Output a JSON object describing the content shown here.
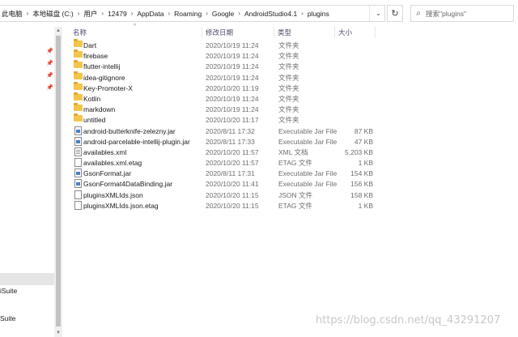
{
  "address_bar": {
    "crumbs": [
      "此电脑",
      "本地磁盘 (C:)",
      "用户",
      "12479",
      "AppData",
      "Roaming",
      "Google",
      "AndroidStudio4.1",
      "plugins"
    ]
  },
  "search": {
    "placeholder": "搜索\"plugins\""
  },
  "columns": {
    "name": "名称",
    "date": "修改日期",
    "type": "类型",
    "size": "大小"
  },
  "nav": {
    "item_1": "iSuite",
    "item_2": "Suite"
  },
  "files": [
    {
      "name": "Dart",
      "date": "2020/10/19 11:24",
      "type": "文件夹",
      "size": "",
      "icon": "folder"
    },
    {
      "name": "firebase",
      "date": "2020/10/19 11:24",
      "type": "文件夹",
      "size": "",
      "icon": "folder"
    },
    {
      "name": "flutter-intellij",
      "date": "2020/10/19 11:24",
      "type": "文件夹",
      "size": "",
      "icon": "folder"
    },
    {
      "name": "idea-gitignore",
      "date": "2020/10/19 11:24",
      "type": "文件夹",
      "size": "",
      "icon": "folder"
    },
    {
      "name": "Key-Promoter-X",
      "date": "2020/10/20 11:19",
      "type": "文件夹",
      "size": "",
      "icon": "folder"
    },
    {
      "name": "Kotlin",
      "date": "2020/10/19 11:24",
      "type": "文件夹",
      "size": "",
      "icon": "folder"
    },
    {
      "name": "markdown",
      "date": "2020/10/19 11:24",
      "type": "文件夹",
      "size": "",
      "icon": "folder"
    },
    {
      "name": "untitled",
      "date": "2020/10/20 11:17",
      "type": "文件夹",
      "size": "",
      "icon": "folder"
    },
    {
      "name": "android-butterknife-zelezny.jar",
      "date": "2020/8/11 17:32",
      "type": "Executable Jar File",
      "size": "87 KB",
      "icon": "jar"
    },
    {
      "name": "android-parcelable-intellij-plugin.jar",
      "date": "2020/8/11 17:33",
      "type": "Executable Jar File",
      "size": "47 KB",
      "icon": "jar"
    },
    {
      "name": "availables.xml",
      "date": "2020/10/20 11:57",
      "type": "XML 文档",
      "size": "5,203 KB",
      "icon": "xml"
    },
    {
      "name": "availables.xml.etag",
      "date": "2020/10/20 11:57",
      "type": "ETAG 文件",
      "size": "1 KB",
      "icon": "file"
    },
    {
      "name": "GsonFormat.jar",
      "date": "2020/8/11 17:31",
      "type": "Executable Jar File",
      "size": "154 KB",
      "icon": "jar"
    },
    {
      "name": "GsonFormat4DataBinding.jar",
      "date": "2020/10/20 11:41",
      "type": "Executable Jar File",
      "size": "156 KB",
      "icon": "jar"
    },
    {
      "name": "pluginsXMLIds.json",
      "date": "2020/10/20 11:15",
      "type": "JSON 文件",
      "size": "158 KB",
      "icon": "file"
    },
    {
      "name": "pluginsXMLIds.json.etag",
      "date": "2020/10/20 11:15",
      "type": "ETAG 文件",
      "size": "1 KB",
      "icon": "file"
    }
  ],
  "watermark": "https://blog.csdn.net/qq_43291207"
}
